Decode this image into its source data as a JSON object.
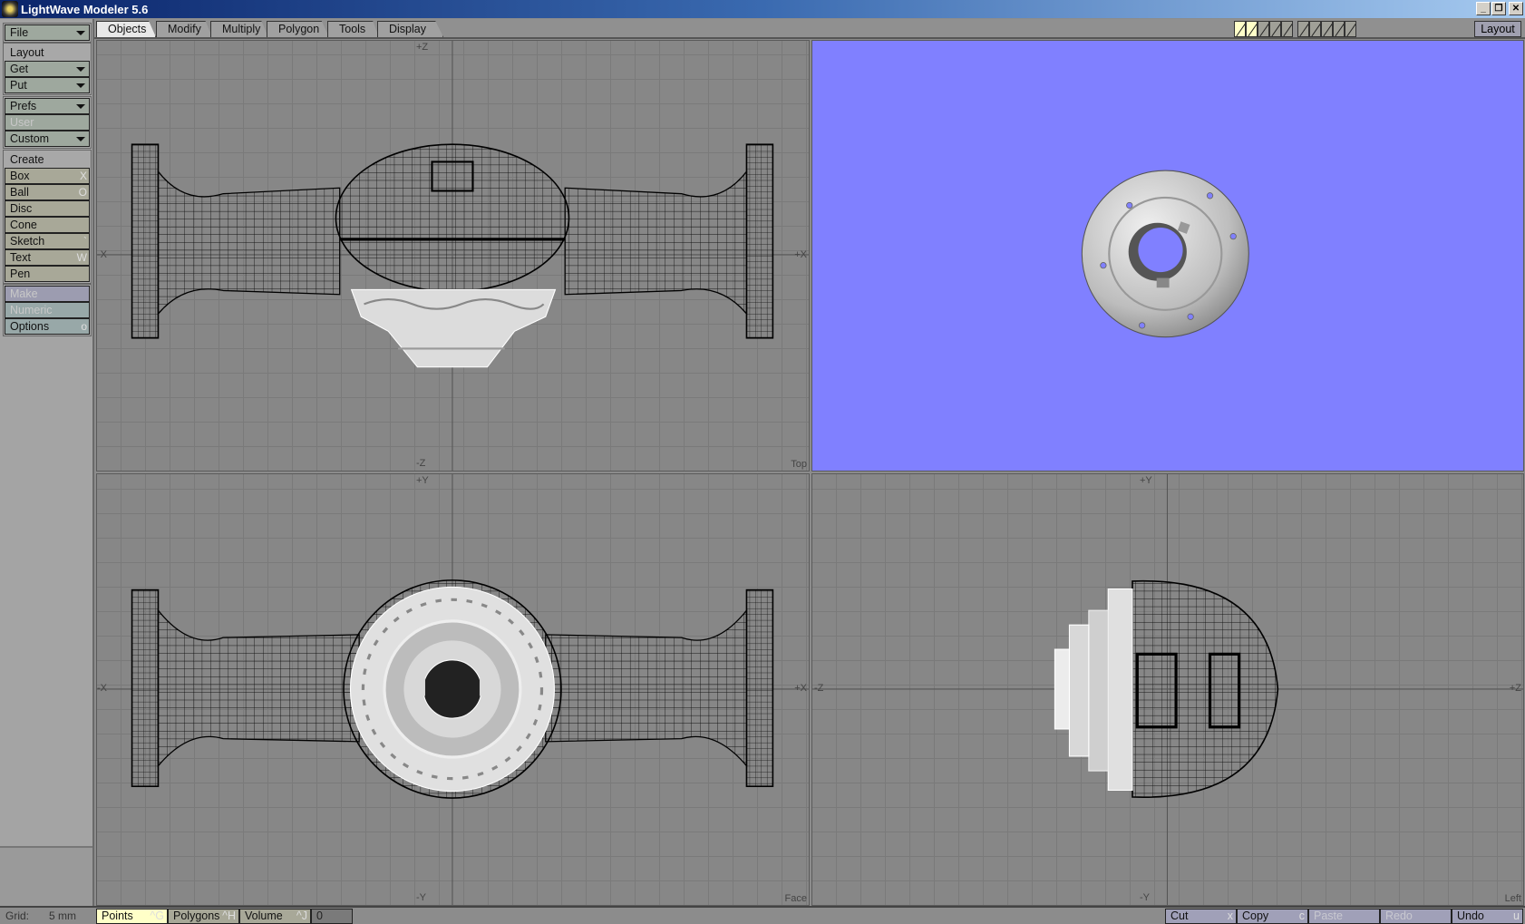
{
  "window": {
    "title": "LightWave Modeler 5.6",
    "minimize": "_",
    "restore": "❐",
    "close": "✕"
  },
  "tabs": [
    {
      "label": "Objects",
      "active": true
    },
    {
      "label": "Modify"
    },
    {
      "label": "Multiply"
    },
    {
      "label": "Polygon"
    },
    {
      "label": "Tools"
    },
    {
      "label": "Display"
    }
  ],
  "toolbar": {
    "layout_label": "Layout",
    "layer_modes": {
      "foreground_active": 1,
      "background_active": 1,
      "total": 10
    }
  },
  "sidebar": {
    "file": "File",
    "layout": "Layout",
    "get": "Get",
    "put": "Put",
    "prefs": "Prefs",
    "user": "User",
    "custom": "Custom",
    "create": "Create",
    "create_items": [
      {
        "label": "Box",
        "key": "X"
      },
      {
        "label": "Ball",
        "key": "O"
      },
      {
        "label": "Disc",
        "key": ""
      },
      {
        "label": "Cone",
        "key": ""
      },
      {
        "label": "Sketch",
        "key": "`"
      },
      {
        "label": "Text",
        "key": "W"
      },
      {
        "label": "Pen",
        "key": ""
      }
    ],
    "make": "Make",
    "numeric": "Numeric",
    "options": "Options",
    "options_key": "o"
  },
  "viewports": {
    "top": {
      "label": "Top",
      "axes": {
        "top": "+Z",
        "bottom": "-Z",
        "left": "-X",
        "right": "+X"
      }
    },
    "face": {
      "label": "Face",
      "axes": {
        "top": "+Y",
        "bottom": "-Y",
        "left": "-X",
        "right": "+X"
      }
    },
    "left": {
      "label": "Left",
      "axes": {
        "top": "+Y",
        "bottom": "-Y",
        "left": "-Z",
        "right": "+Z"
      }
    },
    "perspective": {
      "background": "#8080ff"
    }
  },
  "status": {
    "grid_label": "Grid:",
    "grid_value": "5 mm",
    "points": "Points",
    "points_key": "^G",
    "polygons": "Polygons",
    "polygons_key": "^H",
    "volume": "Volume",
    "volume_key": "^J",
    "count": "0",
    "cut": "Cut",
    "cut_key": "x",
    "copy": "Copy",
    "copy_key": "c",
    "paste": "Paste",
    "redo": "Redo",
    "undo": "Undo",
    "undo_key": "u"
  }
}
